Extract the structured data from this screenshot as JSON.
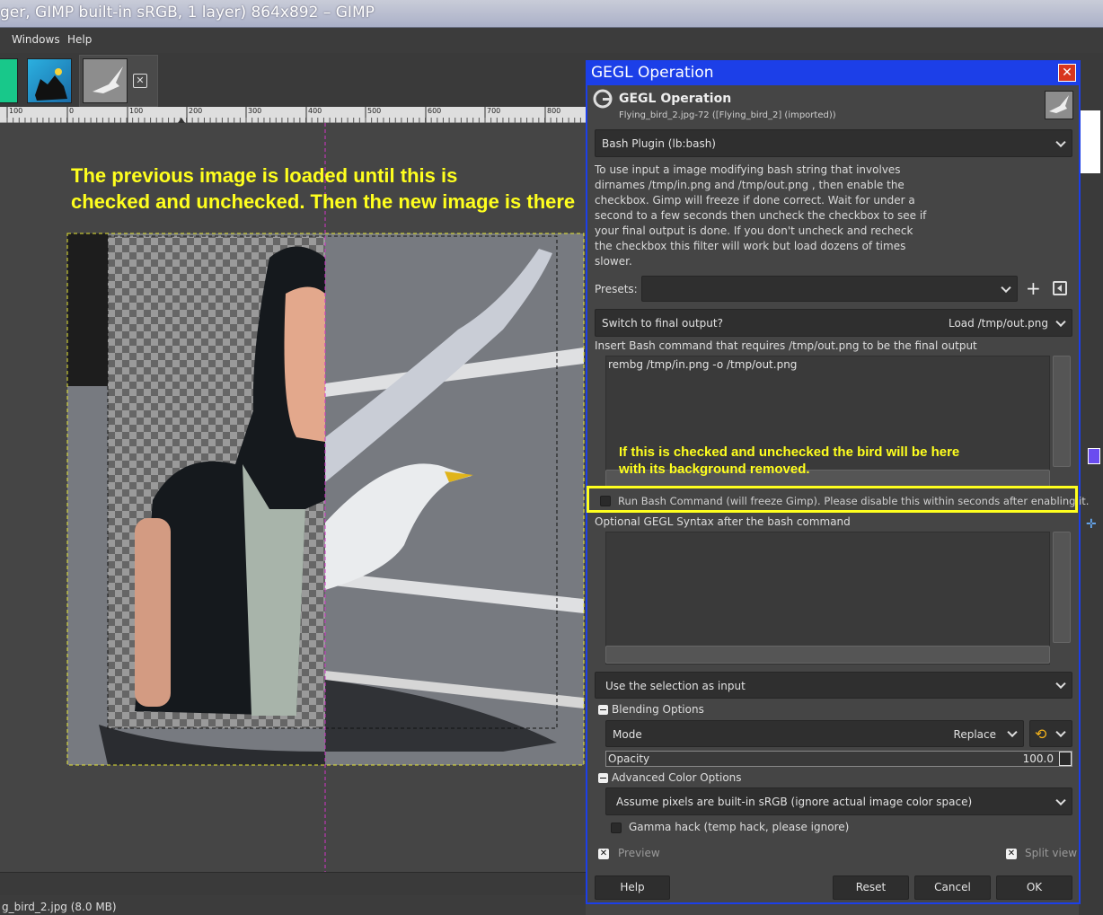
{
  "window": {
    "title": "ger, GIMP built-in sRGB, 1 layer) 864x892 – GIMP"
  },
  "menu": {
    "windows": "Windows",
    "help": "Help"
  },
  "ruler": {
    "labels": [
      "100",
      "0",
      "100",
      "200",
      "300",
      "400",
      "500",
      "600",
      "700",
      "800"
    ]
  },
  "canvas": {
    "annotation_top": [
      "The previous image is loaded until this is",
      "checked and unchecked. Then the new image is there"
    ],
    "annotation_bird": [
      "If this is checked and unchecked the bird will be here",
      "with its background removed."
    ]
  },
  "status": {
    "text": "g_bird_2.jpg (8.0 MB)"
  },
  "dialog": {
    "title": "GEGL Operation",
    "header_title": "GEGL Operation",
    "header_subtitle": "Flying_bird_2.jpg-72 ([Flying_bird_2] (imported))",
    "operation": "Bash Plugin (lb:bash)",
    "description": [
      "To use input a image modifying bash string that involves",
      "dirnames /tmp/in.png and /tmp/out.png , then enable the",
      "checkbox. Gimp will freeze if done correct. Wait for under a",
      "second to a few seconds  then uncheck the checkbox to see if",
      "your final output is done. If you don't uncheck and recheck",
      "the checkbox this filter will work but load dozens of times",
      "slower."
    ],
    "presets_label": "Presets:",
    "presets_value": "",
    "switch_label": "Switch to final output?",
    "switch_value": "Load /tmp/out.png",
    "bash_label": "Insert Bash command that requires /tmp/out.png to be the final output",
    "bash_value": "rembg /tmp/in.png -o /tmp/out.png",
    "run_checkbox_label": "Run Bash Command (will freeze Gimp). Please disable this within seconds after enabling it.",
    "optional_label": "Optional GEGL Syntax after the bash command",
    "optional_value": "",
    "selection": "Use the selection as input",
    "blending_label": "Blending Options",
    "mode_label": "Mode",
    "mode_value": "Replace",
    "opacity_label": "Opacity",
    "opacity_value": "100.0",
    "advanced_label": "Advanced Color Options",
    "color_space": "Assume pixels are built-in sRGB (ignore actual image color space)",
    "gamma_label": "Gamma hack (temp hack, please ignore)",
    "preview_label": "Preview",
    "split_label": "Split view",
    "buttons": {
      "help": "Help",
      "reset": "Reset",
      "cancel": "Cancel",
      "ok": "OK"
    }
  },
  "colors": {
    "annotation": "#ffff1e",
    "dialog_border": "#1c3fe8",
    "highlight_box": "#ffff1e"
  }
}
